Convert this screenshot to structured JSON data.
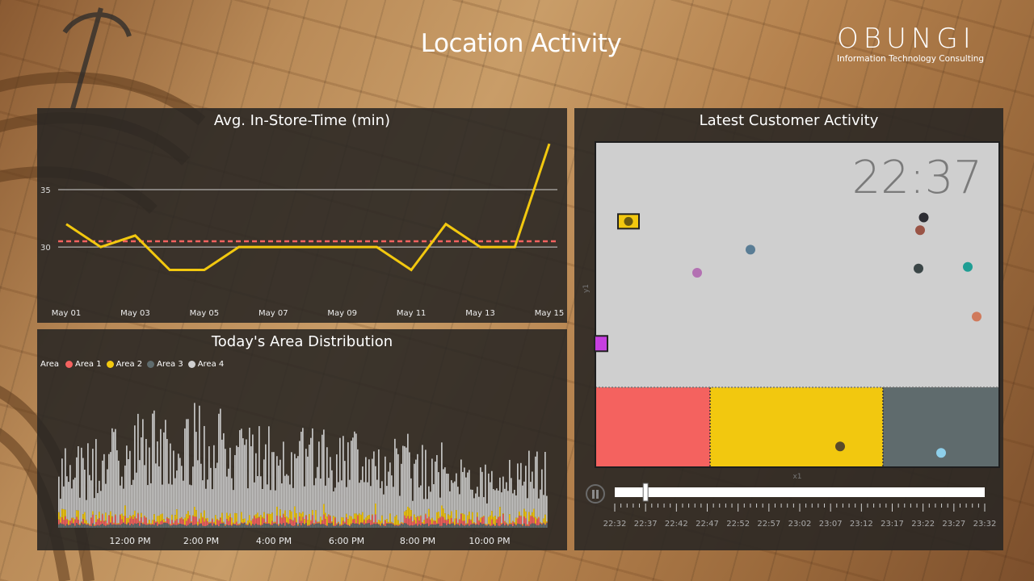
{
  "header": {
    "title": "Location Activity",
    "logo_word": "OBUNGI",
    "logo_tagline": "Information Technology Consulting"
  },
  "avg_panel": {
    "title": "Avg. In-Store-Time (min)"
  },
  "area_panel": {
    "title": "Today's Area Distribution",
    "legend_title": "Area",
    "legend": [
      {
        "label": "Area 1",
        "color": "#f4625f"
      },
      {
        "label": "Area 2",
        "color": "#f2c80f"
      },
      {
        "label": "Area 3",
        "color": "#5f6b6d"
      },
      {
        "label": "Area 4",
        "color": "#d0d0d0"
      }
    ]
  },
  "latest_panel": {
    "title": "Latest Customer Activity",
    "clock": "22:37",
    "x_axis_label": "x1",
    "y_axis_label": "y1",
    "time_ticks": [
      "22:32",
      "22:37",
      "22:42",
      "22:47",
      "22:52",
      "22:57",
      "23:02",
      "23:07",
      "23:12",
      "23:17",
      "23:22",
      "23:27",
      "23:32"
    ],
    "slider_value": "22:37",
    "area_colors": [
      "#f4625f",
      "#f2c80f",
      "#5f6b6d"
    ],
    "pause_icon": "pause-icon"
  },
  "chart_data": [
    {
      "type": "line",
      "title": "Avg. In-Store-Time (min)",
      "x": [
        "May 01",
        "May 02",
        "May 03",
        "May 04",
        "May 05",
        "May 06",
        "May 07",
        "May 08",
        "May 09",
        "May 10",
        "May 11",
        "May 12",
        "May 13",
        "May 14",
        "May 15"
      ],
      "x_tick_labels": [
        "May 01",
        "May 03",
        "May 05",
        "May 07",
        "May 09",
        "May 11",
        "May 13",
        "May 15"
      ],
      "series": [
        {
          "values": [
            32,
            30,
            31,
            28,
            28,
            30,
            30,
            30,
            30,
            30,
            28,
            32,
            30,
            30,
            39
          ],
          "color": "#f2c80f"
        }
      ],
      "reference_line": {
        "value": 30.5,
        "color": "#f4625f",
        "style": "dashed"
      },
      "y_ticks": [
        30,
        35
      ],
      "ylim": [
        25.5,
        40
      ],
      "grid": true
    },
    {
      "type": "bar",
      "title": "Today's Area Distribution",
      "stacked": true,
      "x_tick_labels": [
        "12:00 PM",
        "2:00 PM",
        "4:00 PM",
        "6:00 PM",
        "8:00 PM",
        "10:00 PM"
      ],
      "series": [
        {
          "name": "Area 1",
          "color": "#f4625f"
        },
        {
          "name": "Area 2",
          "color": "#f2c80f"
        },
        {
          "name": "Area 3",
          "color": "#5f6b6d"
        },
        {
          "name": "Area 4",
          "color": "#d0d0d0"
        }
      ]
    },
    {
      "type": "scatter",
      "title": "Latest Customer Activity",
      "xlim": [
        0,
        100
      ],
      "ylim": [
        0,
        100
      ],
      "points": [
        {
          "x": 8.2,
          "y": 75.6,
          "color": "#6a5a10",
          "marker": "square-highlight"
        },
        {
          "x": 1.6,
          "y": 37.9,
          "color": "#c63fe0",
          "marker": "square"
        },
        {
          "x": 25.2,
          "y": 59.8,
          "color": "#b371b2"
        },
        {
          "x": 38.4,
          "y": 66.9,
          "color": "#5a7d95"
        },
        {
          "x": 81.3,
          "y": 76.8,
          "color": "#2d2d33"
        },
        {
          "x": 80.4,
          "y": 72.9,
          "color": "#9a5446"
        },
        {
          "x": 80.0,
          "y": 61.1,
          "color": "#3b4647"
        },
        {
          "x": 92.2,
          "y": 61.6,
          "color": "#1f9e94"
        },
        {
          "x": 94.4,
          "y": 46.3,
          "color": "#d07a5c"
        },
        {
          "x": 60.6,
          "y": 6.4,
          "color": "#5a4a2a"
        },
        {
          "x": 85.6,
          "y": 4.4,
          "color": "#8ecfea"
        }
      ]
    }
  ]
}
